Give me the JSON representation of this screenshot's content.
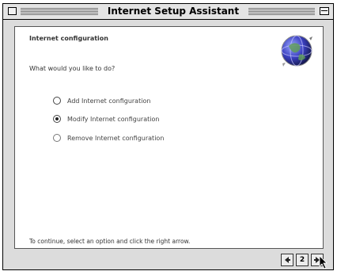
{
  "window": {
    "title": "Internet Setup Assistant"
  },
  "header": {
    "heading": "Internet configuration",
    "logo_icon": "globe-icon"
  },
  "main": {
    "prompt": "What would you like to do?",
    "options": [
      {
        "label": "Add Internet configuration",
        "selected": false
      },
      {
        "label": "Modify Internet configuration",
        "selected": true
      },
      {
        "label": "Remove Internet configuration",
        "selected": false
      }
    ],
    "instruction": "To continue, select an option and click the right arrow."
  },
  "navigation": {
    "page_number": "2",
    "back_icon": "left-arrow-icon",
    "forward_icon": "right-arrow-icon"
  },
  "colors": {
    "window_background": "#dcdcdc",
    "content_background": "#ffffff",
    "title_stripe": "#7a7a7a"
  }
}
